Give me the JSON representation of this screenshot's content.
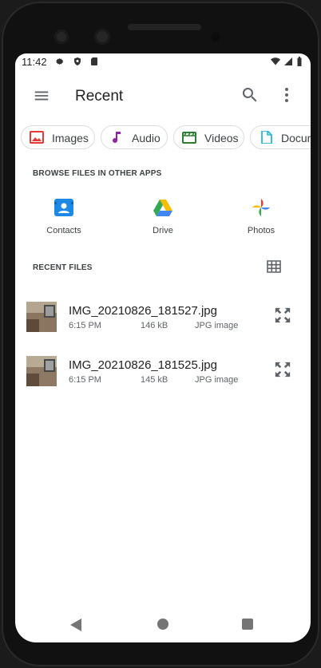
{
  "status_bar": {
    "time": "11:42"
  },
  "app_bar": {
    "title": "Recent"
  },
  "chips": [
    {
      "label": "Images",
      "icon": "image-icon",
      "color": "#e53935"
    },
    {
      "label": "Audio",
      "icon": "music-note-icon",
      "color": "#8e24aa"
    },
    {
      "label": "Videos",
      "icon": "video-icon",
      "color": "#2e7d32"
    },
    {
      "label": "Docum",
      "icon": "document-icon",
      "color": "#29b6d6"
    }
  ],
  "browse_section": {
    "heading": "BROWSE FILES IN OTHER APPS",
    "apps": [
      {
        "label": "Contacts",
        "icon": "contacts-icon"
      },
      {
        "label": "Drive",
        "icon": "drive-icon"
      },
      {
        "label": "Photos",
        "icon": "photos-icon"
      }
    ]
  },
  "recent_section": {
    "heading": "RECENT FILES",
    "files": [
      {
        "name": "IMG_20210826_181527.jpg",
        "time": "6:15 PM",
        "size": "146 kB",
        "type": "JPG image"
      },
      {
        "name": "IMG_20210826_181525.jpg",
        "time": "6:15 PM",
        "size": "145 kB",
        "type": "JPG image"
      }
    ]
  },
  "colors": {
    "accent": "#1a73e8",
    "text_primary": "#202124",
    "text_secondary": "#5f6368"
  }
}
